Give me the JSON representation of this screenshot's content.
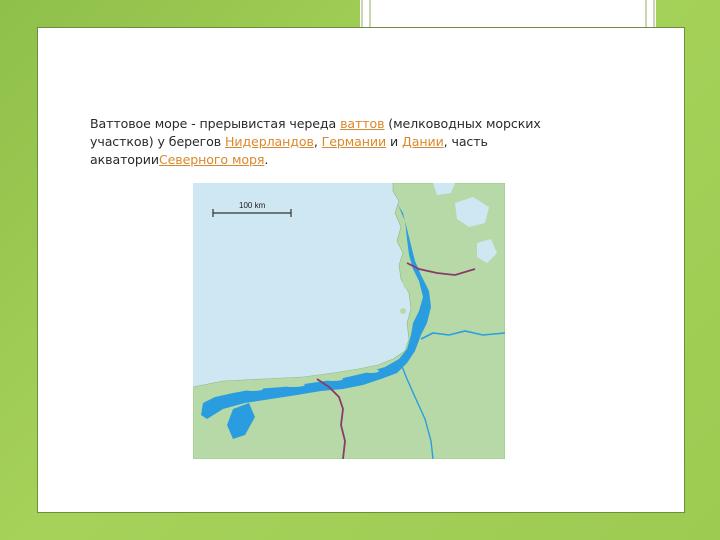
{
  "slide": {
    "paragraph": {
      "part1": "Ваттовое море - прерывистая череда ",
      "link_watts": "ваттов",
      "part2": " (мелководных морских участков) у берегов ",
      "link_netherlands": "Нидерландов",
      "sep1": ", ",
      "link_germany": "Германии",
      "sep2": " и ",
      "link_denmark": "Дании",
      "part3": ", часть акватории",
      "link_north_sea": "Северного моря",
      "end": "."
    },
    "map": {
      "scale_label": "100 km",
      "colors": {
        "sea": "#cfe6f3",
        "land": "#b7d9a8",
        "wadden": "#2a9de0",
        "border": "#8a3a6a"
      }
    }
  }
}
